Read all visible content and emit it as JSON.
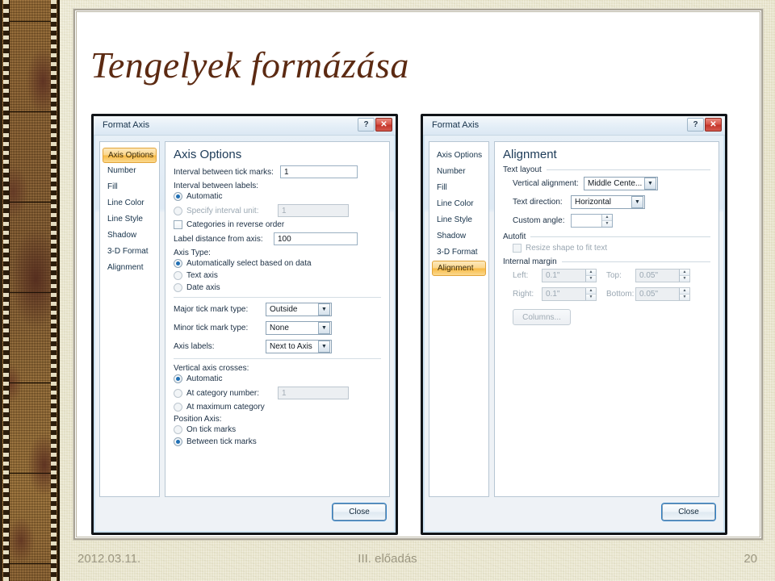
{
  "slide": {
    "title": "Tengelyek formázása",
    "title_color": "#5c2a12",
    "background_color": "#eae7cd",
    "accent_color": "#f7b943"
  },
  "footer": {
    "date": "2012.03.11.",
    "center": "III. előadás",
    "page_number": "20"
  },
  "dialog_left": {
    "titlebar": {
      "title": "Format Axis",
      "help_label": "?",
      "close_label": "✕"
    },
    "categories": [
      {
        "label": "Axis Options",
        "selected": true
      },
      {
        "label": "Number",
        "selected": false
      },
      {
        "label": "Fill",
        "selected": false
      },
      {
        "label": "Line Color",
        "selected": false
      },
      {
        "label": "Line Style",
        "selected": false
      },
      {
        "label": "Shadow",
        "selected": false
      },
      {
        "label": "3-D Format",
        "selected": false
      },
      {
        "label": "Alignment",
        "selected": false
      }
    ],
    "pane_title": "Axis Options",
    "interval_tick_label": "Interval between tick marks:",
    "interval_tick_value": "1",
    "interval_labels_label": "Interval between labels:",
    "interval_automatic": "Automatic",
    "interval_specify": "Specify interval unit:",
    "interval_specify_value": "1",
    "categories_reverse": "Categories in reverse order",
    "label_distance_label": "Label distance from axis:",
    "label_distance_value": "100",
    "axis_type_label": "Axis Type:",
    "axis_type_auto": "Automatically select based on data",
    "axis_type_text": "Text axis",
    "axis_type_date": "Date axis",
    "major_tick_label": "Major tick mark type:",
    "major_tick_value": "Outside",
    "minor_tick_label": "Minor tick mark type:",
    "minor_tick_value": "None",
    "axis_labels_label": "Axis labels:",
    "axis_labels_value": "Next to Axis",
    "vcross_label": "Vertical axis crosses:",
    "vcross_auto": "Automatic",
    "vcross_category": "At category number:",
    "vcross_category_value": "1",
    "vcross_max": "At maximum category",
    "position_axis_label": "Position Axis:",
    "position_on_tick": "On tick marks",
    "position_between_tick": "Between tick marks",
    "close_button": "Close"
  },
  "dialog_right": {
    "titlebar": {
      "title": "Format Axis",
      "help_label": "?",
      "close_label": "✕"
    },
    "categories": [
      {
        "label": "Axis Options",
        "selected": false
      },
      {
        "label": "Number",
        "selected": false
      },
      {
        "label": "Fill",
        "selected": false
      },
      {
        "label": "Line Color",
        "selected": false
      },
      {
        "label": "Line Style",
        "selected": false
      },
      {
        "label": "Shadow",
        "selected": false
      },
      {
        "label": "3-D Format",
        "selected": false
      },
      {
        "label": "Alignment",
        "selected": true
      }
    ],
    "pane_title": "Alignment",
    "text_layout_group": "Text layout",
    "vertical_alignment_label": "Vertical alignment:",
    "vertical_alignment_value": "Middle Cente...",
    "text_direction_label": "Text direction:",
    "text_direction_value": "Horizontal",
    "custom_angle_label": "Custom angle:",
    "custom_angle_value": "",
    "autofit_group": "Autofit",
    "resize_shape_label": "Resize shape to fit text",
    "internal_margin_group": "Internal margin",
    "left_label": "Left:",
    "left_value": "0.1\"",
    "top_label": "Top:",
    "top_value": "0.05\"",
    "right_label": "Right:",
    "right_value": "0.1\"",
    "bottom_label": "Bottom:",
    "bottom_value": "0.05\"",
    "columns_button": "Columns...",
    "close_button": "Close"
  }
}
